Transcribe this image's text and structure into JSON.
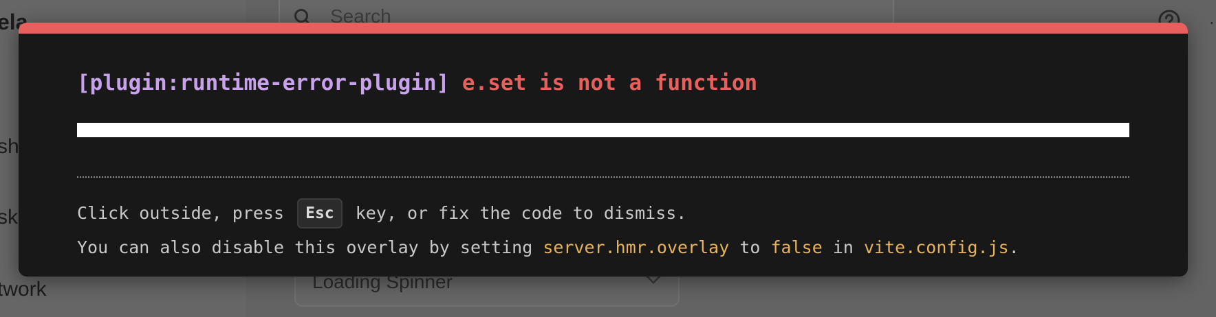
{
  "background": {
    "logo_fragment": "ela",
    "sidebar_fragments": [
      "sh",
      "sk",
      "twork"
    ],
    "search": {
      "placeholder": "Search"
    },
    "select": {
      "value": "Loading Spinner"
    },
    "icons": [
      "search-icon",
      "help-icon",
      "chevron-down-icon"
    ]
  },
  "overlay": {
    "title": {
      "plugin": "[plugin:runtime-error-plugin]",
      "message": "e.set is not a function"
    },
    "frame": "",
    "tip_line1": {
      "before": "Click outside, press",
      "key": "Esc",
      "after": "key, or fix the code to dismiss."
    },
    "tip_line2": {
      "text1": "You can also disable this overlay by setting",
      "code1": "server.hmr.overlay",
      "text2": "to",
      "code2": "false",
      "text3": "in",
      "code3": "vite.config.js",
      "text4": "."
    },
    "colors": {
      "accent": "#e8605d",
      "plugin": "#c8a2ec",
      "code": "#e6b35c",
      "background": "#181818"
    }
  }
}
